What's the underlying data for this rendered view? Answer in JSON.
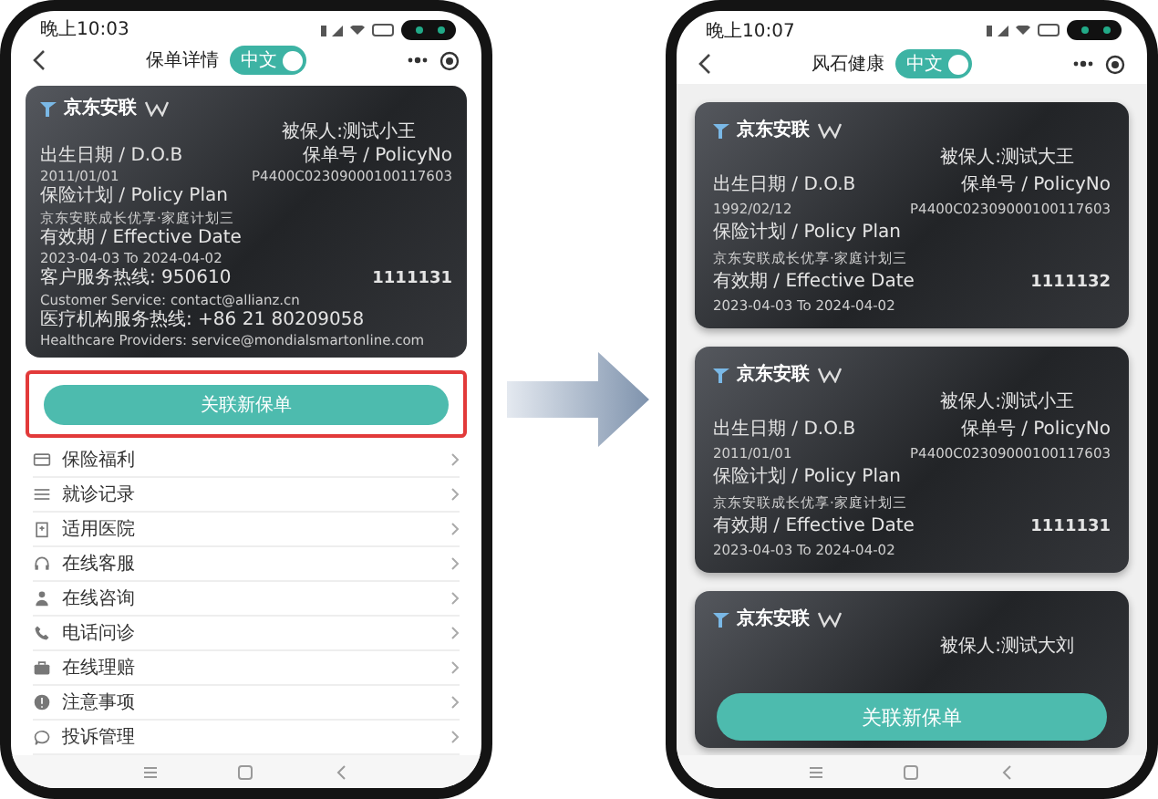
{
  "left_phone": {
    "status_time": "晚上10:03",
    "title": "保单详情",
    "lang_toggle": {
      "label": "中文",
      "on": true
    },
    "card": {
      "brand": "京东安联",
      "insured": "被保人:测试小王",
      "dob_label": "出生日期 / D.O.B",
      "dob": "2011/01/01",
      "policy_label": "保单号 / PolicyNo",
      "policy_no": "P4400C02309000100117603",
      "plan_label": "保险计划 / Policy Plan",
      "plan": "京东安联成长优享·家庭计划三",
      "effective_label": "有效期 / Effective Date",
      "effective_dates": "2023-04-03 To 2024-04-02",
      "hotline": "客户服务热线: 950610",
      "member_no": "1111131",
      "customer_service": "Customer Service: contact@allianz.cn",
      "provider_hotline": "医疗机构服务热线: +86 21 80209058",
      "provider_email": "Healthcare Providers: service@mondialsmartonline.com"
    },
    "button": {
      "label": "关联新保单",
      "highlighted": true
    },
    "menu": [
      {
        "label": "保险福利",
        "kind": "card"
      },
      {
        "label": "就诊记录",
        "kind": "list"
      },
      {
        "label": "适用医院",
        "kind": "hospital"
      },
      {
        "label": "在线客服",
        "kind": "headset"
      },
      {
        "label": "在线咨询",
        "kind": "person"
      },
      {
        "label": "电话问诊",
        "kind": "phone"
      },
      {
        "label": "在线理赔",
        "kind": "claim"
      },
      {
        "label": "注意事项",
        "kind": "info"
      },
      {
        "label": "投诉管理",
        "kind": "chat"
      }
    ]
  },
  "right_phone": {
    "status_time": "晚上10:07",
    "title": "风石健康",
    "lang_toggle": {
      "label": "中文",
      "on": true
    },
    "cards": [
      {
        "brand": "京东安联",
        "insured": "被保人:测试大王",
        "dob_label": "出生日期 / D.O.B",
        "dob": "1992/02/12",
        "policy_label": "保单号 / PolicyNo",
        "policy_no": "P4400C02309000100117603",
        "plan_label": "保险计划 / Policy Plan",
        "plan": "京东安联成长优享·家庭计划三",
        "effective_label": "有效期 / Effective Date",
        "member_no": "1111132",
        "effective_dates": "2023-04-03 To 2024-04-02"
      },
      {
        "brand": "京东安联",
        "insured": "被保人:测试小王",
        "dob_label": "出生日期 / D.O.B",
        "dob": "2011/01/01",
        "policy_label": "保单号 / PolicyNo",
        "policy_no": "P4400C02309000100117603",
        "plan_label": "保险计划 / Policy Plan",
        "plan": "京东安联成长优享·家庭计划三",
        "effective_label": "有效期 / Effective Date",
        "member_no": "1111131",
        "effective_dates": "2023-04-03 To 2024-04-02"
      },
      {
        "brand": "京东安联",
        "insured": "被保人:测试大刘"
      }
    ],
    "button": {
      "label": "关联新保单"
    }
  }
}
